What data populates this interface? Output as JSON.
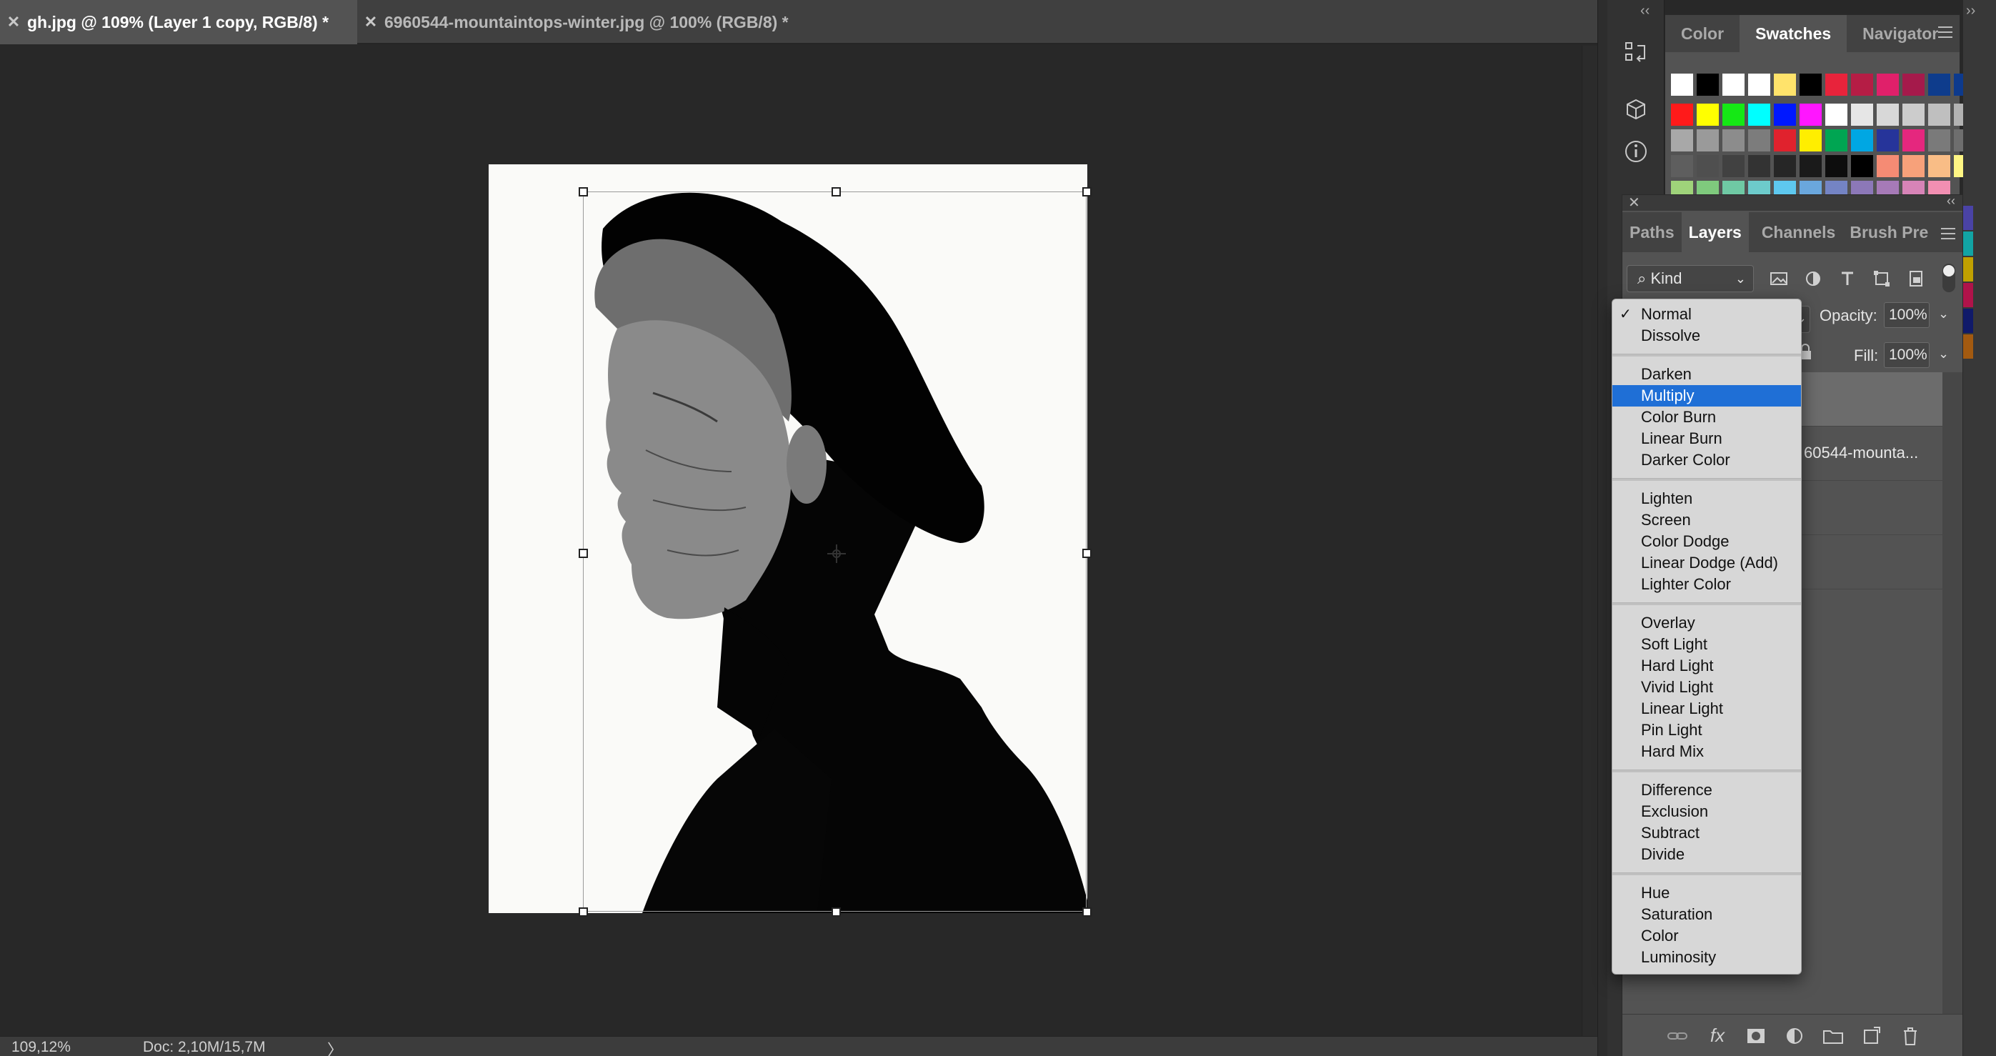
{
  "tabs": [
    {
      "title": "gh.jpg @ 109% (Layer 1 copy, RGB/8) *",
      "active": true
    },
    {
      "title": "6960544-mountaintops-winter.jpg @ 100% (RGB/8) *",
      "active": false
    }
  ],
  "status_bar": {
    "zoom": "109,12%",
    "doc_size": "Doc: 2,10M/15,7M",
    "arrow": "〉"
  },
  "swatch_panel": {
    "tabs": [
      "Color",
      "Swatches",
      "Navigator"
    ],
    "active_tab": "Swatches",
    "rows": [
      [
        "#ffffff",
        "#000000",
        "#ffffff",
        "#ffffff",
        "#ffe36b",
        "#000000",
        "#e8233b",
        "#b51d45",
        "#e0206a",
        "#a51a4b",
        "#0e3c8c",
        "#0d3a8d",
        "#0f3c96"
      ],
      [
        "#ff1a1a",
        "#ffff00",
        "#15e815",
        "#00ffff",
        "#0018ff",
        "#ff16ff",
        "#ffffff",
        "#e6e6e6",
        "#d8d8d8",
        "#cccccc",
        "#bfbfbf",
        "#b2b2b2"
      ],
      [
        "#a8a8a8",
        "#9a9a9a",
        "#8c8c8c",
        "#7c7c7c",
        "#e0222d",
        "#ffee00",
        "#00a552",
        "#00a7e3",
        "#26349a",
        "#e5277e",
        "#7a7a7a",
        "#6e6e6e"
      ],
      [
        "#5e5e5e",
        "#4f4f4f",
        "#414141",
        "#333333",
        "#262626",
        "#1a1a1a",
        "#0d0d0d",
        "#000000",
        "#f58b74",
        "#f7a17a",
        "#f9bd86",
        "#fff684"
      ],
      [
        "#9fd37a",
        "#7fca7d",
        "#6fc9a4",
        "#6dcbcb",
        "#5ec8ef",
        "#6aa7dd",
        "#7484c4",
        "#8c78b8",
        "#a67ab7",
        "#d784b7",
        "#f28fb2"
      ]
    ]
  },
  "layers_panel": {
    "tabs": [
      "Paths",
      "Layers",
      "Channels",
      "Brush Pre"
    ],
    "active_tab": "Layers",
    "kind_filter": "Kind",
    "filter_icons": [
      "image-filter-icon",
      "adjustment-filter-icon",
      "type-filter-icon",
      "shape-filter-icon",
      "smart-object-filter-icon"
    ],
    "opacity_label": "Opacity:",
    "opacity_value": "100%",
    "fill_label": "Fill:",
    "fill_value": "100%",
    "layers": [
      {
        "name": "",
        "selected": true
      },
      {
        "name": "60544-mounta...",
        "selected": false
      },
      {
        "name": "",
        "selected": false
      },
      {
        "name": "",
        "selected": false
      }
    ],
    "bottom_icons": [
      "link-icon",
      "fx-icon",
      "mask-icon",
      "adjustment-icon",
      "folder-icon",
      "new-layer-icon",
      "trash-icon"
    ],
    "fx_label": "fx"
  },
  "blend_menu": {
    "selected": "Normal",
    "highlighted": "Multiply",
    "groups": [
      [
        "Normal",
        "Dissolve"
      ],
      [
        "Darken",
        "Multiply",
        "Color Burn",
        "Linear Burn",
        "Darker Color"
      ],
      [
        "Lighten",
        "Screen",
        "Color Dodge",
        "Linear Dodge (Add)",
        "Lighter Color"
      ],
      [
        "Overlay",
        "Soft Light",
        "Hard Light",
        "Vivid Light",
        "Linear Light",
        "Pin Light",
        "Hard Mix"
      ],
      [
        "Difference",
        "Exclusion",
        "Subtract",
        "Divide"
      ],
      [
        "Hue",
        "Saturation",
        "Color",
        "Luminosity"
      ]
    ]
  },
  "edge_swatches": [
    "#4a43a6",
    "#12a4a4",
    "#c0a000",
    "#b0134a",
    "#101a6a",
    "#a35a10"
  ]
}
